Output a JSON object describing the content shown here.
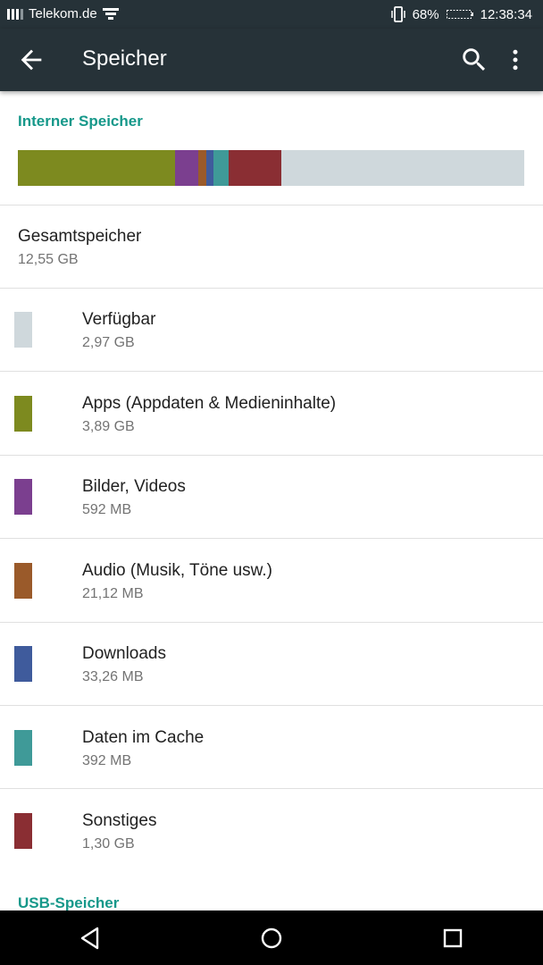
{
  "status": {
    "carrier": "Telekom.de",
    "battery": "68%",
    "time": "12:38:34"
  },
  "appbar": {
    "title": "Speicher",
    "icons": [
      "arrow-back-icon",
      "search-icon",
      "more-vert-icon"
    ]
  },
  "internal": {
    "header": "Interner Speicher",
    "total_label": "Gesamtspeicher",
    "total_value": "12,55 GB",
    "bar_segments": [
      {
        "category": "Apps (Appdaten & Medieninhalte)",
        "color": "#7d8a1f",
        "fraction": 0.31
      },
      {
        "category": "Bilder, Videos",
        "color": "#7b3f8f",
        "fraction": 0.047
      },
      {
        "category": "Audio (Musik, Töne usw.)",
        "color": "#9a5a2a",
        "fraction": 0.015
      },
      {
        "category": "Downloads",
        "color": "#3f5b9c",
        "fraction": 0.015
      },
      {
        "category": "Daten im Cache",
        "color": "#3f9a98",
        "fraction": 0.03
      },
      {
        "category": "Sonstiges",
        "color": "#8a2e33",
        "fraction": 0.104
      },
      {
        "category": "Verfügbar",
        "color": "#cfd8dc",
        "fraction": 0.479
      }
    ],
    "items": [
      {
        "label": "Verfügbar",
        "value": "2,97 GB",
        "color": "#cfd8dc"
      },
      {
        "label": "Apps (Appdaten & Medieninhalte)",
        "value": "3,89 GB",
        "color": "#7d8a1f"
      },
      {
        "label": "Bilder, Videos",
        "value": "592 MB",
        "color": "#7b3f8f"
      },
      {
        "label": "Audio (Musik, Töne usw.)",
        "value": "21,12 MB",
        "color": "#9a5a2a"
      },
      {
        "label": "Downloads",
        "value": "33,26 MB",
        "color": "#3f5b9c"
      },
      {
        "label": "Daten im Cache",
        "value": "392 MB",
        "color": "#3f9a98"
      },
      {
        "label": "Sonstiges",
        "value": "1,30 GB",
        "color": "#8a2e33"
      }
    ]
  },
  "usb": {
    "header": "USB-Speicher"
  },
  "navbar": {
    "icons": [
      "back-nav-icon",
      "home-nav-icon",
      "recents-nav-icon"
    ]
  }
}
